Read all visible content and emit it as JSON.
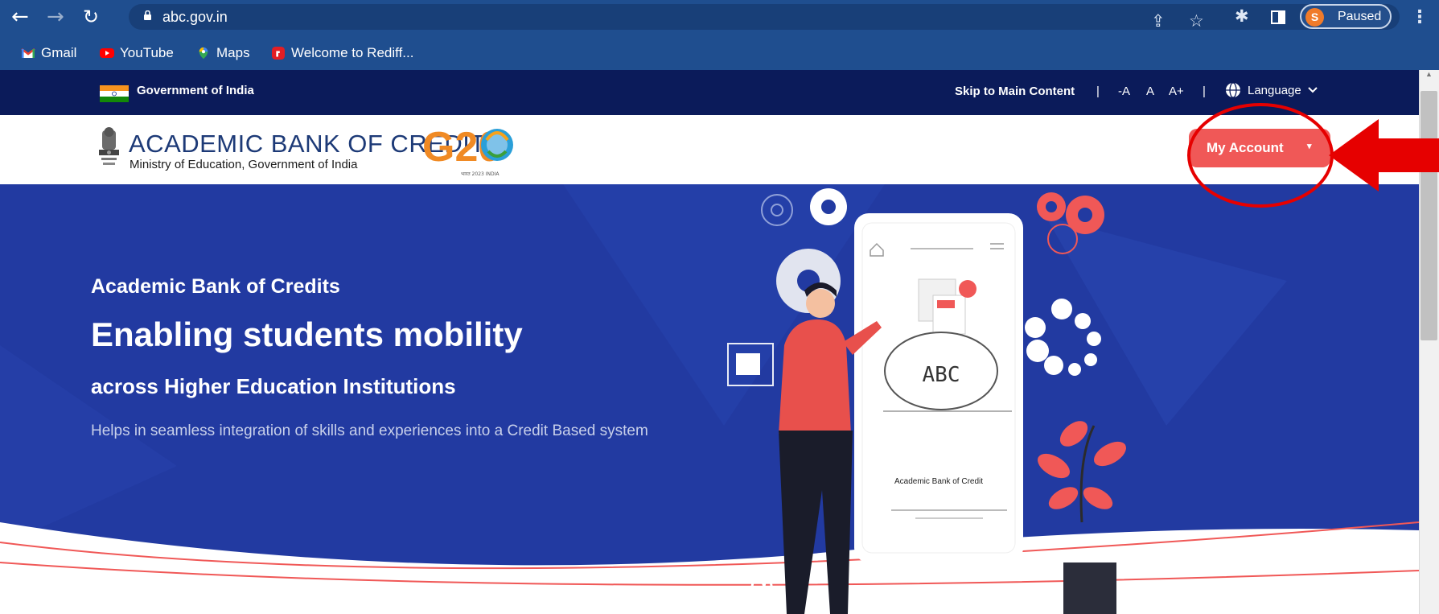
{
  "browser": {
    "url": "abc.gov.in",
    "profile_initial": "S",
    "profile_status": "Paused",
    "bookmarks": [
      {
        "label": "Gmail"
      },
      {
        "label": "YouTube"
      },
      {
        "label": "Maps"
      },
      {
        "label": "Welcome to Rediff..."
      }
    ]
  },
  "gov_bar": {
    "left_label": "Government of India",
    "skip_label": "Skip to Main Content",
    "text_size_controls": [
      "-A",
      "A",
      "A+"
    ],
    "language_label": "Language"
  },
  "header": {
    "brand_title": "ACADEMIC BANK OF CREDITS",
    "brand_subtitle": "Ministry of Education, Government of India",
    "g20_text": "G20",
    "g20_caption": "भारत 2023 INDIA",
    "my_account_label": "My Account"
  },
  "hero": {
    "title": "Academic Bank of Credits",
    "heading": "Enabling students mobility",
    "subheading": "across Higher Education Institutions",
    "description": "Helps in seamless integration of skills and experiences into a Credit Based system",
    "phone_label": "Academic Bank of Credit",
    "piggy_text": "ABC"
  },
  "colors": {
    "browser_bar": "#1f4e8f",
    "gov_bar": "#0b1b5a",
    "hero_bg": "#223aa1",
    "brand_blue": "#1d3a77",
    "my_account_bg": "#f05857",
    "annotation_red": "#e60000"
  }
}
